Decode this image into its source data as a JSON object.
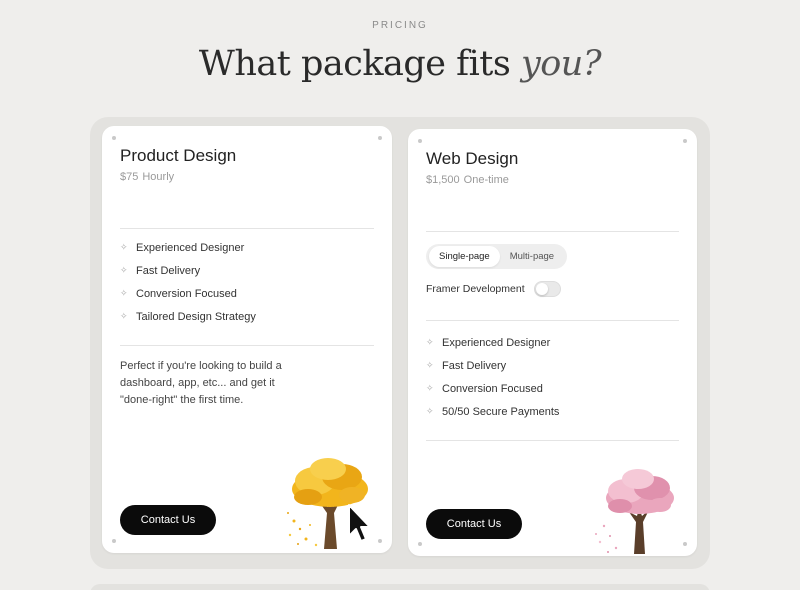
{
  "header": {
    "eyebrow": "PRICING",
    "headline_main": "What package fits ",
    "headline_em": "you?"
  },
  "cards": [
    {
      "title": "Product Design",
      "price": "$75",
      "unit": "Hourly",
      "features": [
        "Experienced Designer",
        "Fast Delivery",
        "Conversion Focused",
        "Tailored Design Strategy"
      ],
      "description": "Perfect if you're looking to build a dashboard, app, etc... and get it \"done-right\" the first time.",
      "cta": "Contact Us",
      "tree_color": "#f2b51c"
    },
    {
      "title": "Web Design",
      "price": "$1,500",
      "unit": "One-time",
      "options": [
        "Single-page",
        "Multi-page"
      ],
      "selected_option": "Single-page",
      "toggle_label": "Framer Development",
      "toggle_on": false,
      "features": [
        "Experienced Designer",
        "Fast Delivery",
        "Conversion Focused",
        "50/50 Secure Payments"
      ],
      "cta": "Contact Us",
      "tree_color": "#eaa6bd"
    }
  ],
  "icons": {
    "feature_bullet": "sparkle-icon",
    "pointer": "cursor-icon"
  }
}
